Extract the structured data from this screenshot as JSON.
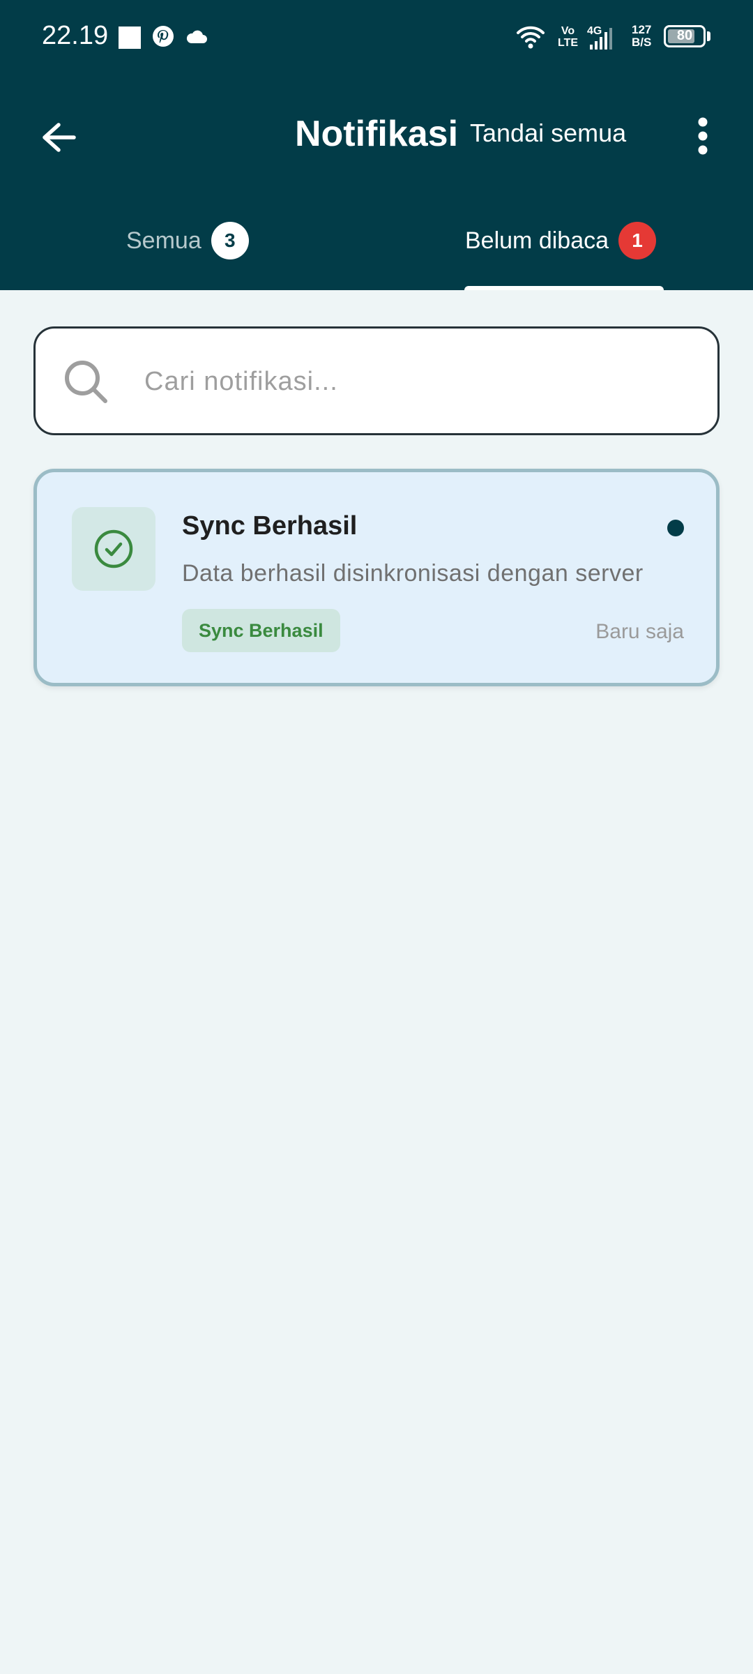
{
  "status_bar": {
    "time": "22.19",
    "volte": [
      "Vo",
      "LTE"
    ],
    "network": "4G",
    "speed": [
      "127",
      "B/S"
    ],
    "battery": "80",
    "battery_level": 0.8,
    "icons": [
      "square-notification-icon",
      "pinterest-icon",
      "cloud-icon",
      "wifi-icon",
      "signal-icon",
      "battery-icon"
    ]
  },
  "app_bar": {
    "title": "Notifikasi",
    "mark_all_label": "Tandai semua",
    "back_icon": "arrow-left-icon",
    "more_icon": "more-vertical-icon"
  },
  "tabs": [
    {
      "label": "Semua",
      "count": "3",
      "selected": false
    },
    {
      "label": "Belum dibaca",
      "count": "1",
      "selected": true
    }
  ],
  "search": {
    "placeholder": "Cari notifikasi...",
    "value": "",
    "icon": "search-icon"
  },
  "notifications": [
    {
      "title": "Sync Berhasil",
      "message": "Data berhasil disinkronisasi dengan server",
      "tag": "Sync Berhasil",
      "time": "Baru saja",
      "unread": true,
      "icon": "check-circle-icon"
    }
  ],
  "colors": {
    "header_bg": "#023c48",
    "page_bg": "#eef5f6",
    "card_bg": "#e2f0fb",
    "card_border": "#9bbcc6",
    "success": "#3a8a3f",
    "badge_red": "#e53935"
  }
}
